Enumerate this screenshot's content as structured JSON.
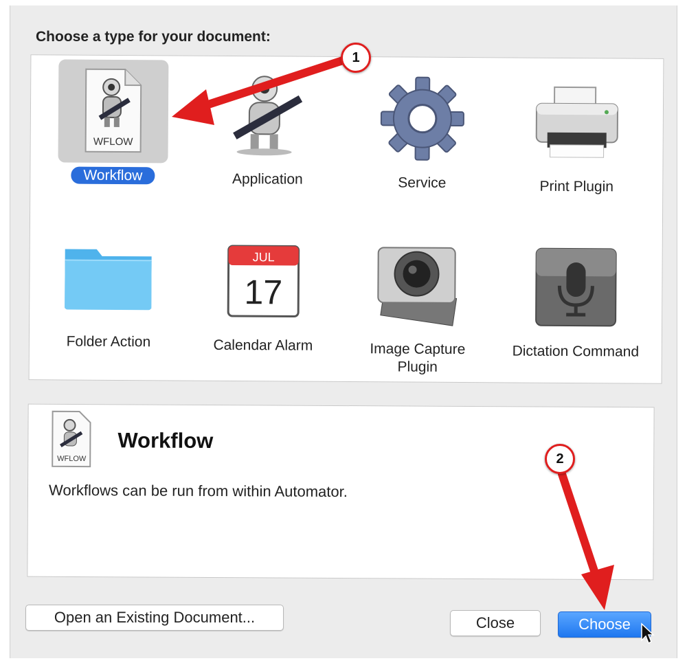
{
  "dialog": {
    "heading": "Choose a type for your document:",
    "types": [
      {
        "label": "Workflow",
        "icon": "workflow-document-icon",
        "selected": true
      },
      {
        "label": "Application",
        "icon": "automator-robot-icon"
      },
      {
        "label": "Service",
        "icon": "gear-icon"
      },
      {
        "label": "Print Plugin",
        "icon": "printer-icon"
      },
      {
        "label": "Folder Action",
        "icon": "folder-icon"
      },
      {
        "label": "Calendar Alarm",
        "icon": "calendar-icon"
      },
      {
        "label": "Image Capture Plugin",
        "icon": "camera-icon"
      },
      {
        "label": "Dictation Command",
        "icon": "microphone-icon"
      }
    ],
    "calendar": {
      "month": "JUL",
      "day": "17"
    },
    "workflow_badge": "WFLOW",
    "description": {
      "title": "Workflow",
      "text": "Workflows can be run from within Automator.",
      "badge": "WFLOW"
    },
    "buttons": {
      "open_existing": "Open an Existing Document...",
      "close": "Close",
      "choose": "Choose"
    },
    "annotations": {
      "marker_1": "1",
      "marker_2": "2",
      "arrow_color": "#e01e1e"
    },
    "colors": {
      "selection": "#2a6ddb",
      "primary_button": "#1f78f0"
    }
  }
}
